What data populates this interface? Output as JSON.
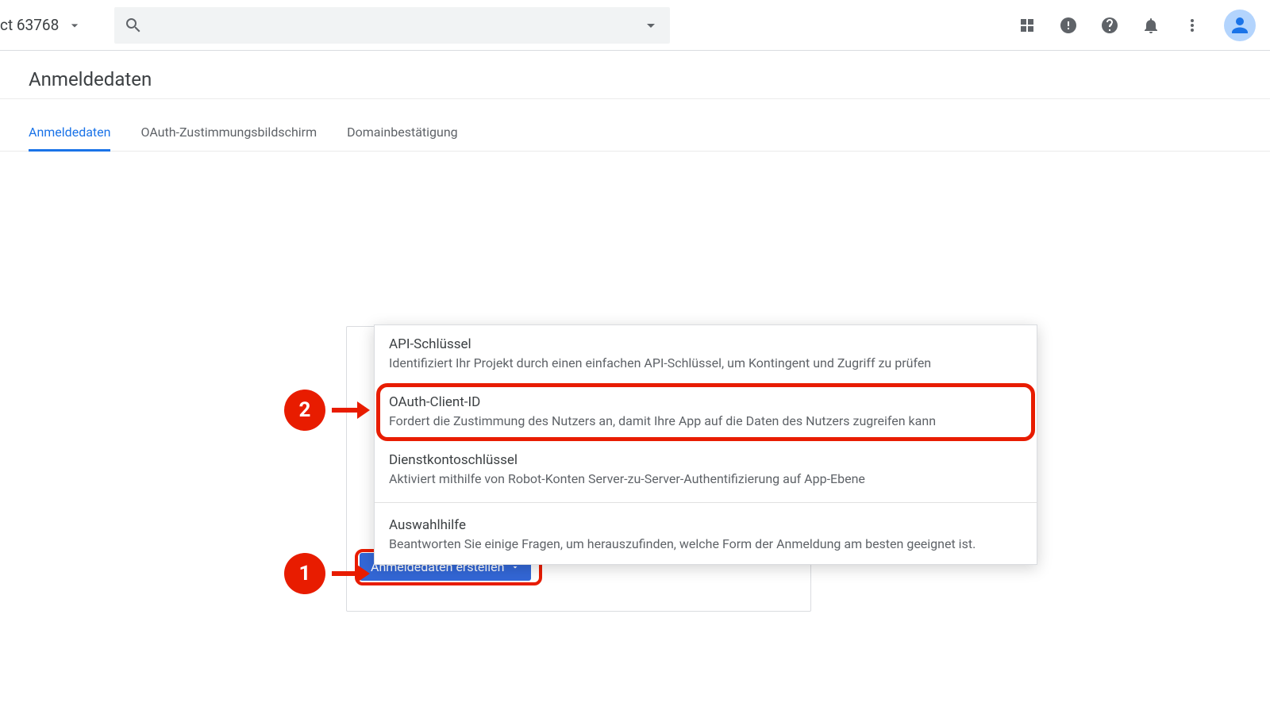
{
  "topbar": {
    "project_name": "ct 63768",
    "search_placeholder": ""
  },
  "page": {
    "title": "Anmeldedaten"
  },
  "tabs": [
    {
      "label": "Anmeldedaten",
      "active": true
    },
    {
      "label": "OAuth-Zustimmungsbildschirm",
      "active": false
    },
    {
      "label": "Domainbestätigung",
      "active": false
    }
  ],
  "create_button": {
    "label": "Anmeldedaten erstellen"
  },
  "menu": [
    {
      "title": "API-Schlüssel",
      "desc": "Identifiziert Ihr Projekt durch einen einfachen API-Schlüssel, um Kontingent und Zugriff zu prüfen",
      "highlight": false
    },
    {
      "title": "OAuth-Client-ID",
      "desc": "Fordert die Zustimmung des Nutzers an, damit Ihre App auf die Daten des Nutzers zugreifen kann",
      "highlight": true
    },
    {
      "title": "Dienstkontoschlüssel",
      "desc": "Aktiviert mithilfe von Robot-Konten Server-zu-Server-Authentifizierung auf App-Ebene",
      "highlight": false
    },
    {
      "title": "Auswahlhilfe",
      "desc": "Beantworten Sie einige Fragen, um herauszufinden, welche Form der Anmeldung am besten geeignet ist.",
      "highlight": false
    }
  ],
  "annotations": {
    "one": "1",
    "two": "2"
  }
}
